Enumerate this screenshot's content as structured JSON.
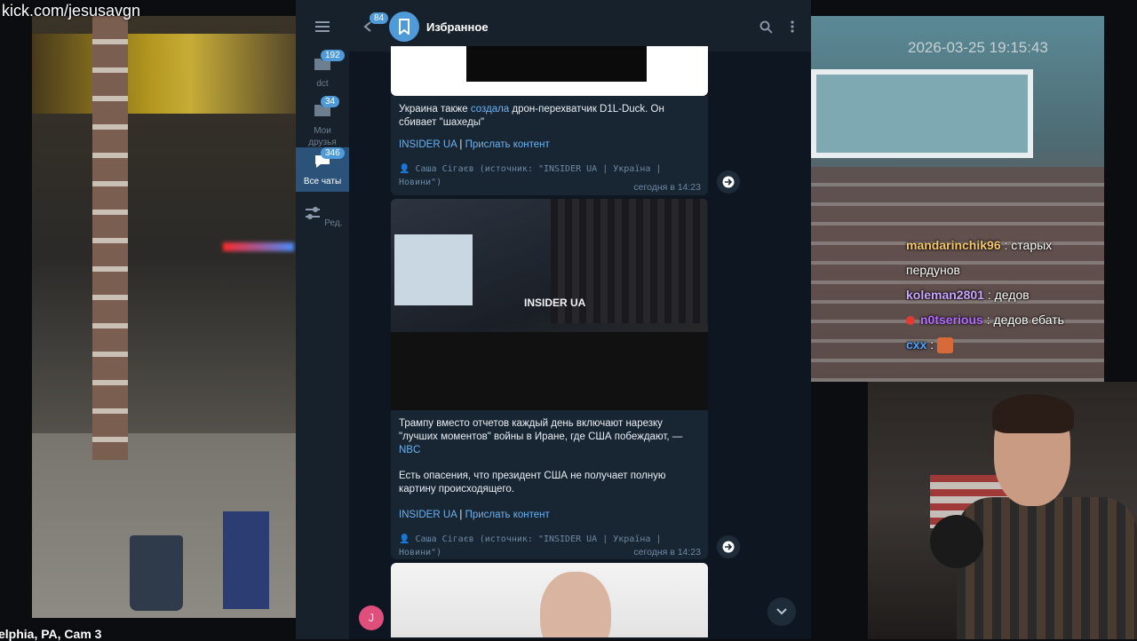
{
  "stream": {
    "url": "kick.com/jesusavgn",
    "cam_label": "elphia, PA, Cam 3",
    "timestamp": "2026-03-25 19:15:43",
    "chat": [
      {
        "user": "mandarinchik96",
        "text": ": старых пердунов"
      },
      {
        "user": "koleman2801",
        "text": ": дедов"
      },
      {
        "user": "n0tserious",
        "text": ": дедов ебать"
      },
      {
        "user": "cxx",
        "text": ":"
      }
    ]
  },
  "telegram": {
    "header": {
      "title": "Избранное",
      "back_badge": "84"
    },
    "rail": [
      {
        "label": "dct",
        "badge": "192",
        "icon": "folder-icon"
      },
      {
        "label": "Мои друзья",
        "badge": "34",
        "icon": "folder-icon"
      },
      {
        "label": "Все чаты",
        "badge": "346",
        "icon": "chats-icon"
      },
      {
        "label": "Ред.",
        "badge": "",
        "icon": "sliders-icon"
      }
    ],
    "messages": [
      {
        "text_before_link": "Украина также ",
        "text_link": "создала",
        "text_after_link": " дрон-перехватчик D1L-Duck. Он сбивает \"шахеды\"",
        "source_link": "INSIDER UA",
        "separator": "|",
        "submit_link": "Прислать контент",
        "signature": "👤 Саша Сігаєв (источник: \"INSIDER UA | Україна | Новини\")",
        "time": "сегодня в 14:23"
      },
      {
        "watermark": "INSIDER UA",
        "text1": "Трампу вместо отчетов каждый день включают нарезку \"лучших моментов\" войны в Иране, где США побеждают, —",
        "text1_link": "NBC",
        "text2": "Есть опасения, что президент США не получает полную картину происходящего.",
        "source_link": "INSIDER UA",
        "separator": "|",
        "submit_link": "Прислать контент",
        "signature": "👤 Саша Сігаєв (источник: \"INSIDER UA | Україна | Новини\")",
        "time": "сегодня в 14:23"
      }
    ],
    "user_avatar_letter": "J"
  },
  "colors": {
    "accent": "#4f9ad8",
    "link": "#6ab3f3",
    "bg": "#0e1621",
    "panel": "#17212b"
  }
}
